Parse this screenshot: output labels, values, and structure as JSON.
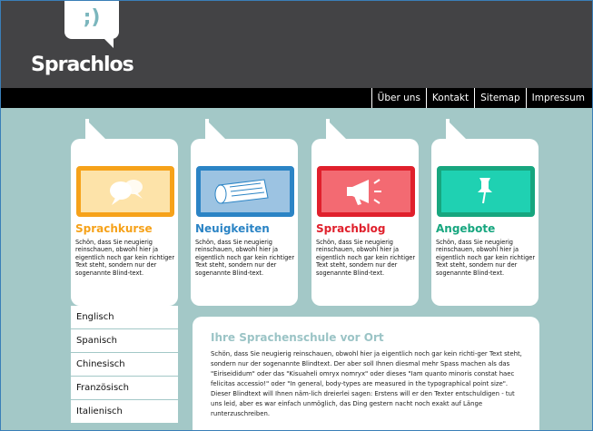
{
  "brand": {
    "logo_glyph": ";)",
    "name": "Sprachlos"
  },
  "nav": {
    "items": [
      "Über uns",
      "Kontakt",
      "Sitemap",
      "Impressum"
    ]
  },
  "cards": [
    {
      "title": "Sprachkurse",
      "color": "#f6a21a",
      "bg": "#fde3a9",
      "icon": "speech-bubbles-icon",
      "text": "Schön, dass Sie neugierig reinschauen, obwohl hier ja eigentlich noch gar kein richtiger Text steht, sondern nur der sogenannte Blind-text."
    },
    {
      "title": "Neuigkeiten",
      "color": "#2b84c5",
      "bg": "#9cc3e2",
      "icon": "newspaper-icon",
      "text": "Schön, dass Sie neugierig reinschauen, obwohl hier ja eigentlich noch gar kein richtiger Text steht, sondern nur der sogenannte Blind-text."
    },
    {
      "title": "Sprachblog",
      "color": "#e0202c",
      "bg": "#f36a72",
      "icon": "megaphone-icon",
      "text": "Schön, dass Sie neugierig reinschauen, obwohl hier ja eigentlich noch gar kein richtiger Text steht, sondern nur der sogenannte Blind-text."
    },
    {
      "title": "Angebote",
      "color": "#17a67f",
      "bg": "#1fd1b2",
      "icon": "pushpin-icon",
      "text": "Schön, dass Sie neugierig reinschauen, obwohl hier ja eigentlich noch gar kein richtiger Text steht, sondern nur der sogenannte Blind-text."
    }
  ],
  "languages": [
    "Englisch",
    "Spanisch",
    "Chinesisch",
    "Französisch",
    "Italienisch"
  ],
  "main": {
    "title": "Ihre Sprachenschule vor Ort",
    "text": "Schön, dass Sie neugierig reinschauen, obwohl hier ja eigentlich noch gar kein richti-ger Text steht, sondern nur der sogenannte Blindtext. Der aber soll Ihnen diesmal mehr Spass machen als das \"Eiriseididum\" oder das \"Kisuaheli omryx nomryx\" oder dieses \"Iam quanto minoris constat haec felicitas accessio!\" oder \"In general, body-types are measured in the typographical point size\". Dieser Blindtext will Ihnen näm-lich dreierlei sagen: Erstens will er den Texter entschuldigen - tut uns leid, aber es war einfach unmöglich, das Ding gestern nacht noch exakt auf Länge runterzuschreiben."
  }
}
